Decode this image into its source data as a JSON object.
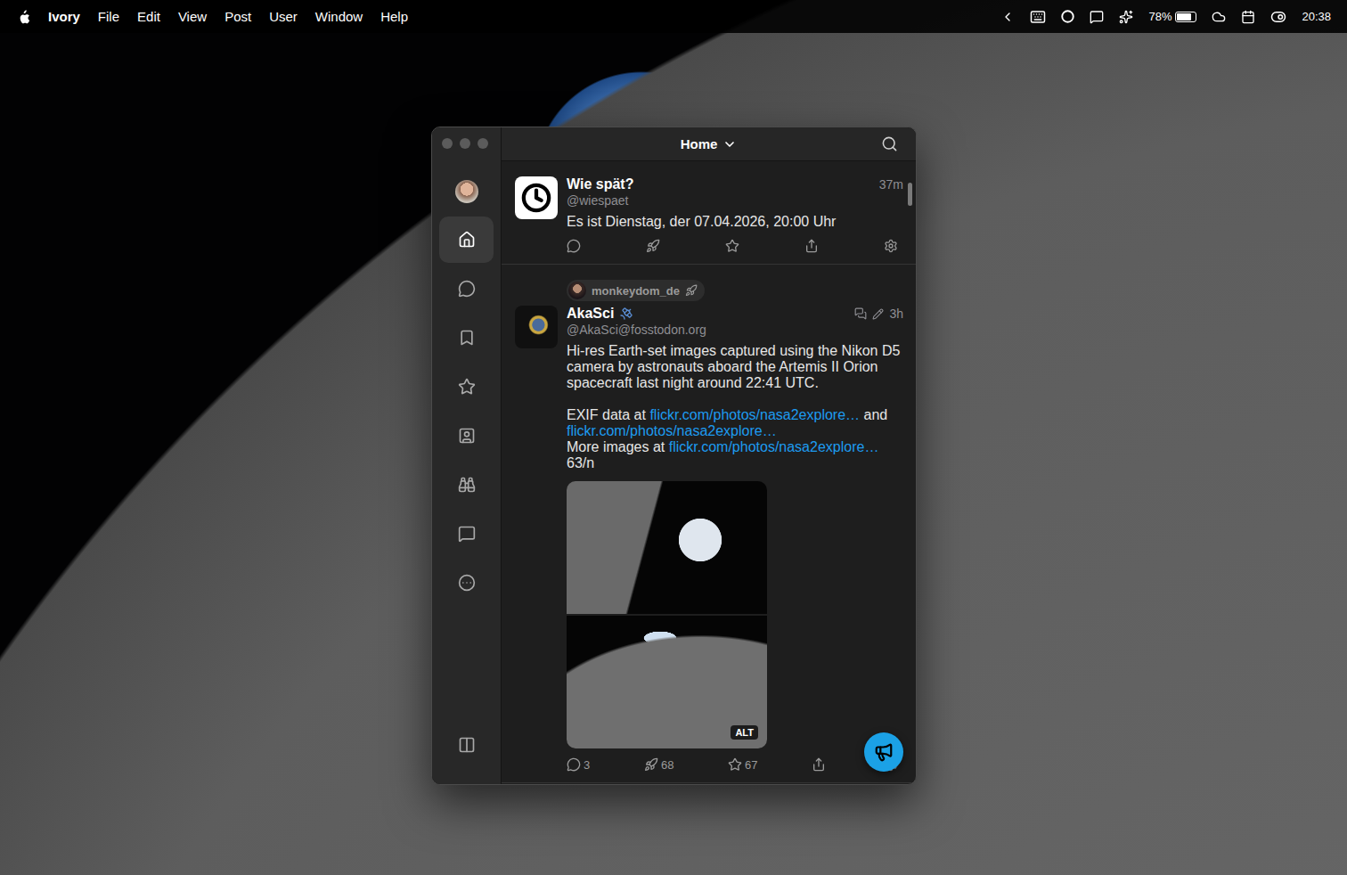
{
  "menubar": {
    "app": "Ivory",
    "menus": [
      "File",
      "Edit",
      "View",
      "Post",
      "User",
      "Window",
      "Help"
    ],
    "battery": "78%",
    "battery_level": 0.78,
    "time": "20:38"
  },
  "window": {
    "title": "Home"
  },
  "sidebar": {
    "items": [
      {
        "selected": true
      },
      {
        "selected": false
      },
      {
        "selected": false
      },
      {
        "selected": false
      },
      {
        "selected": false
      },
      {
        "selected": false
      },
      {
        "selected": false
      },
      {
        "selected": false
      }
    ]
  },
  "posts": [
    {
      "boosted_by": "",
      "avatar_kind": "logo",
      "name": "Wie spät?",
      "handle": "@wiespaet",
      "time": "37m",
      "thread": false,
      "edited": false,
      "content": [
        [
          [
            {
              "text": "Es ist Dienstag, der 07.04.2026, 20:00 Uhr",
              "link": false
            }
          ]
        ]
      ],
      "media": {
        "count": 0,
        "alt_badge": ""
      },
      "replies": "",
      "boosts": "",
      "favorites": ""
    },
    {
      "boosted_by": "monkeydom_de",
      "avatar_kind": "photo",
      "name": "AkaSci",
      "handle": "@AkaSci@fosstodon.org",
      "time": "3h",
      "thread": true,
      "edited": true,
      "content": [
        [
          [
            {
              "text": "Hi-res Earth-set images captured using the Nikon D5 camera by astronauts aboard the Artemis II Orion spacecraft last night around 22:41 UTC.",
              "link": false
            }
          ]
        ],
        [
          [
            {
              "text": "EXIF data at ",
              "link": false
            },
            {
              "text": "flickr.com/photos/nasa2explore…",
              "link": true
            },
            {
              "text": " and ",
              "link": false
            },
            {
              "text": "flickr.com/photos/nasa2explore…",
              "link": true
            }
          ],
          [
            {
              "text": "More images at ",
              "link": false
            },
            {
              "text": "flickr.com/photos/nasa2explore…",
              "link": true
            }
          ],
          [
            {
              "text": "63/n",
              "link": false
            }
          ]
        ]
      ],
      "media": {
        "count": 2,
        "alt_badge": "ALT"
      },
      "replies": "3",
      "boosts": "68",
      "favorites": "67"
    }
  ]
}
